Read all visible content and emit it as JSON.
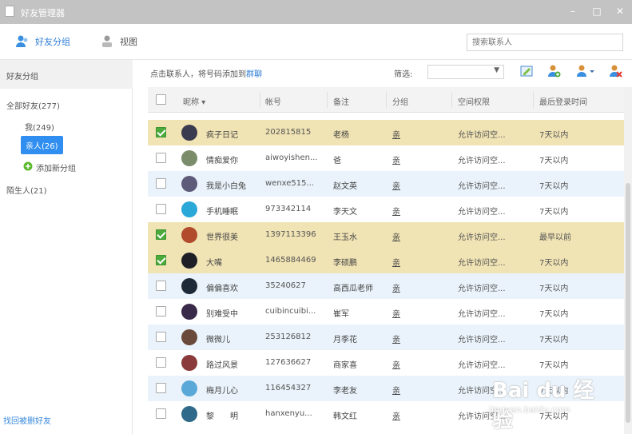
{
  "window": {
    "title": "好友管理器"
  },
  "toolbar": {
    "tab_friends": "好友分组",
    "tab_view": "视图",
    "search_placeholder": "搜索联系人"
  },
  "sidebar": {
    "header": "好友分组",
    "all_friends": "全部好友(277)",
    "group_1": "我(249)",
    "group_2": "亲人(26)",
    "add_group": "添加新分组",
    "strangers": "陌生人(21)",
    "footer_link": "找回被删好友"
  },
  "main": {
    "info_text": "点击联系人，将号码添加到",
    "info_link": "群聊",
    "filter_label": "筛选:",
    "filter_value": "",
    "colors": {
      "selected_row": "#f0e3b4",
      "alt_row": "#eaf3fb",
      "accent": "#2f8ef0",
      "check": "#4caa3c"
    }
  },
  "table": {
    "columns": [
      "昵称",
      "帐号",
      "备注",
      "分组",
      "空间权限",
      "最后登录时间"
    ],
    "rows": [
      {
        "checked": true,
        "name": "疯子日记",
        "num": "202815815",
        "note": "老杨",
        "group": "亲",
        "perm": "允许访问空...",
        "last": "7天以内",
        "avatar": "#3b3b4f",
        "style": "sel"
      },
      {
        "checked": false,
        "name": "情痴爱你",
        "num": "aiwoyishen...",
        "note": "爸",
        "group": "亲",
        "perm": "允许访问空...",
        "last": "7天以内",
        "avatar": "#7a8c6a",
        "style": "white"
      },
      {
        "checked": false,
        "name": "我是小白兔",
        "num": "wenxe515...",
        "note": "赵文英",
        "group": "亲",
        "perm": "允许访问空...",
        "last": "7天以内",
        "avatar": "#5e5a7a",
        "style": "alt"
      },
      {
        "checked": false,
        "name": "手机睡眠",
        "num": "973342114",
        "note": "李天文",
        "group": "亲",
        "perm": "允许访问空...",
        "last": "7天以内",
        "avatar": "#2aa8d8",
        "style": "white"
      },
      {
        "checked": true,
        "name": "世界很美",
        "num": "1397113396",
        "note": "王玉水",
        "group": "亲",
        "perm": "允许访问空...",
        "last": "最早以前",
        "avatar": "#b24a2c",
        "style": "sel"
      },
      {
        "checked": true,
        "name": "大嘴",
        "num": "1465884469",
        "note": "李硕鹏",
        "group": "亲",
        "perm": "允许访问空...",
        "last": "7天以内",
        "avatar": "#1e1e26",
        "style": "sel"
      },
      {
        "checked": false,
        "name": "偏偏喜欢",
        "num": "35240627",
        "note": "高西瓜老师",
        "group": "亲",
        "perm": "允许访问空...",
        "last": "7天以内",
        "avatar": "#1f2a38",
        "style": "alt"
      },
      {
        "checked": false,
        "name": "别难受中",
        "num": "cuibincuibi...",
        "note": "崔军",
        "group": "亲",
        "perm": "允许访问空...",
        "last": "7天以内",
        "avatar": "#3a2a4a",
        "style": "white"
      },
      {
        "checked": false,
        "name": "微微儿",
        "num": "253126812",
        "note": "月季花",
        "group": "亲",
        "perm": "允许访问空...",
        "last": "7天以内",
        "avatar": "#6a4a3a",
        "style": "alt"
      },
      {
        "checked": false,
        "name": "路过风景",
        "num": "127636627",
        "note": "商家喜",
        "group": "亲",
        "perm": "允许访问空...",
        "last": "7天以内",
        "avatar": "#8a3a3a",
        "style": "white"
      },
      {
        "checked": false,
        "name": "梅月儿心",
        "num": "116454327",
        "note": "李老友",
        "group": "亲",
        "perm": "允许访问空...",
        "last": "7天以内",
        "avatar": "#5aa8d8",
        "style": "alt"
      },
      {
        "checked": false,
        "name": "黎　　明",
        "num": "hanxenyu...",
        "note": "韩文红",
        "group": "亲",
        "perm": "允许访问空...",
        "last": "7天以内",
        "avatar": "#2f6a8a",
        "style": "white"
      }
    ]
  },
  "watermark": {
    "title": "Bai du 经验",
    "subtitle": "jingyan.baidu.com"
  }
}
